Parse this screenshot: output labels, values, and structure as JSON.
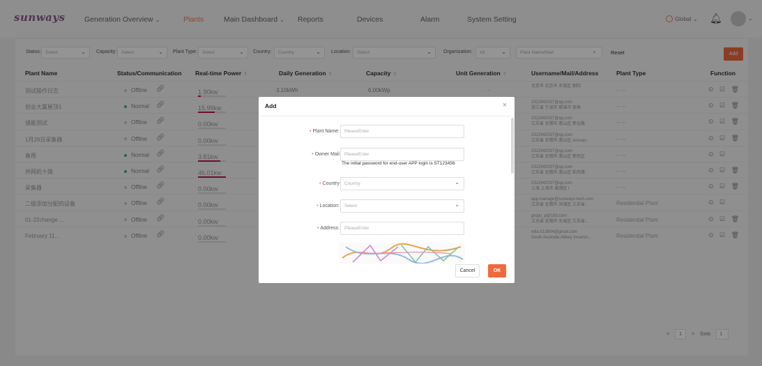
{
  "nav": {
    "logo": "sunways",
    "items": [
      {
        "label": "Generation Overview",
        "chevron": true
      },
      {
        "label": "Plants",
        "active": true
      },
      {
        "label": "Main Dashboard",
        "chevron": true
      },
      {
        "label": "Reports"
      },
      {
        "label": "Devices"
      },
      {
        "label": "Alarm"
      },
      {
        "label": "System Setting"
      }
    ],
    "global_label": "Global",
    "accent": "#f07a5a"
  },
  "filters": {
    "status_label": "Status:",
    "status_value": "Select",
    "capacity_label": "Capacity:",
    "capacity_value": "Select",
    "plant_type_label": "Plant Type:",
    "plant_type_value": "Select",
    "country_label": "Country:",
    "country_value": "Country",
    "location_label": "Location:",
    "location_value": "Select",
    "organization_label": "Organization:",
    "organization_value": "All",
    "search_placeholder": "Plant Name/Mail",
    "reset_label": "Reset",
    "add_label": "Add"
  },
  "table": {
    "headers": {
      "plant_name": "Plant Name",
      "status": "Status/Communication",
      "power": "Real-time Power",
      "daily": "Daily Generation",
      "capacity": "Capacity",
      "unit_gen": "Unit Generation",
      "user": "Username/Mail/Address",
      "type": "Plant Type",
      "function": "Function"
    },
    "rows": [
      {
        "name": "测试操作日志",
        "status": "Offline",
        "status_color": "#cccccc",
        "power": "1.90kw",
        "power_frac": 0.1,
        "daily": "3.10kWh",
        "capacity": "6.00kWp",
        "unit_gen": "--",
        "user1": "北京市 北京市 东城区 朝阳",
        "user2": "",
        "type": "-- --",
        "funcs": "⊙ ☑ 🗑"
      },
      {
        "name": "创业大厦屋顶1",
        "status": "Normal",
        "status_color": "#3cb371",
        "power": "15.99kw",
        "power_frac": 0.6,
        "daily": "",
        "capacity": "",
        "unit_gen": "",
        "user1": "2312942037@qq.com",
        "user2": "浙江省 宁波市 慈溪市 崇寿",
        "type": "-- --",
        "funcs": "⊙ ☑ 🗑"
      },
      {
        "name": "储能测试",
        "status": "Offline",
        "status_color": "#cccccc",
        "power": "0.00kw",
        "power_frac": 0,
        "daily": "",
        "capacity": "",
        "unit_gen": "",
        "user1": "2312942037@qq.com",
        "user2": "江苏省 无锡市 惠山区 新址路",
        "type": "-- --",
        "funcs": "⊙ ☑ 🗑"
      },
      {
        "name": "1月29日采集器",
        "status": "Offline",
        "status_color": "#cccccc",
        "power": "0.00kw",
        "power_frac": 0,
        "daily": "",
        "capacity": "",
        "unit_gen": "",
        "user1": "2312942037@qq.com",
        "user2": "江苏省 无锡市 惠山区 xinxuqu",
        "type": "-- --",
        "funcs": "⊙ ☑ 🗑"
      },
      {
        "name": "备用",
        "status": "Normal",
        "status_color": "#3cb371",
        "power": "3.81kw",
        "power_frac": 0.8,
        "daily": "",
        "capacity": "",
        "unit_gen": "",
        "user1": "2312942037@qq.com",
        "user2": "江苏省 无锡市 惠山区 新民区",
        "type": "-- --",
        "funcs": "⊙ ☑"
      },
      {
        "name": "并网机十路",
        "status": "Normal",
        "status_color": "#3cb371",
        "power": "46.01kw",
        "power_frac": 1.0,
        "daily": "",
        "capacity": "",
        "unit_gen": "",
        "user1": "2312942037@qq.com",
        "user2": "江苏省 无锡市 惠山区 和风路",
        "type": "-- --",
        "funcs": "⊙ ☑ 🗑"
      },
      {
        "name": "采集器",
        "status": "Offline",
        "status_color": "#cccccc",
        "power": "0.00kw",
        "power_frac": 0,
        "daily": "",
        "capacity": "",
        "unit_gen": "",
        "user1": "2312942037@qq.com",
        "user2": "上海 上海市 黄浦区 l",
        "type": "-- --",
        "funcs": "⊙ ☑ 🗑"
      },
      {
        "name": "二级添加分配的设备",
        "status": "Offline",
        "status_color": "#cccccc",
        "power": "0.00kw",
        "power_frac": 0,
        "daily": "",
        "capacity": "",
        "unit_gen": "",
        "user1": "app.manage@sunways-tech.com",
        "user2": "江苏省 无锡市 滨湖区 江苏省...",
        "type": "Residential Plant",
        "funcs": "⊙ ☑"
      },
      {
        "name": "01-22change ...",
        "status": "Offline",
        "status_color": "#cccccc",
        "power": "0.00kw",
        "power_frac": 0,
        "daily": "",
        "capacity": "",
        "unit_gen": "",
        "user1": "gropu_p@163.com",
        "user2": "江苏省 无锡市 东城区 江苏省...",
        "type": "Residential Plant",
        "funcs": "⊙ ☑ 🗑"
      },
      {
        "name": "February 11...",
        "status": "Offline",
        "status_color": "#cccccc",
        "power": "0.00kw",
        "power_frac": 0,
        "daily": "",
        "capacity": "",
        "unit_gen": "",
        "user1": "elita.513804@gmail.com",
        "user2": "South Australia Abbey Innamin...",
        "type": "Residential Plant",
        "funcs": "⊙ ☑ 🗑"
      }
    ]
  },
  "pagination": {
    "prev": "<",
    "current": "1",
    "next": ">",
    "goto_label": "Goto",
    "goto_value": "1"
  },
  "modal": {
    "title": "Add",
    "close": "×",
    "fields": [
      {
        "label": "Plant Name:",
        "placeholder": "PleaseEnter"
      },
      {
        "label": "Owner Mail",
        "placeholder": "PleaseEnter"
      },
      {
        "label": "Country",
        "placeholder": "Country"
      },
      {
        "label": "Location:",
        "placeholder": "Select"
      },
      {
        "label": "Address:",
        "placeholder": "PleaseEnter"
      }
    ],
    "hint": "The initial password for end-user APP login is ST123456",
    "cancel": "Cancel",
    "ok": "OK"
  }
}
